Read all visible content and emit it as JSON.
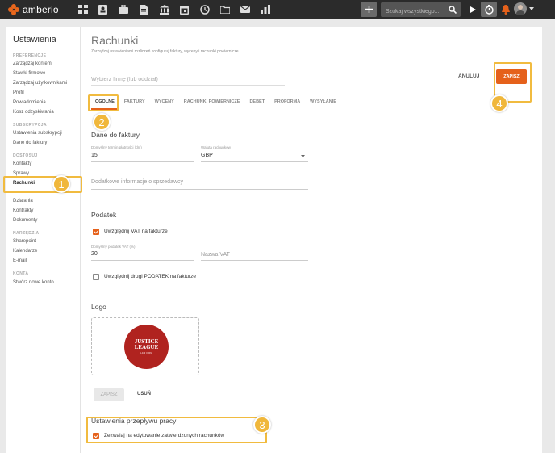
{
  "topbar": {
    "brand": "amberio",
    "search_placeholder": "Szukaj wszystkiego...",
    "nav_icons": [
      "dashboard-icon",
      "contacts-icon",
      "briefcase-icon",
      "document-icon",
      "bank-icon",
      "calendar-icon",
      "history-icon",
      "folder-icon",
      "email-icon",
      "chart-icon"
    ],
    "actions": [
      "add-icon",
      "play-icon",
      "timer-icon",
      "notification-icon",
      "user-avatar"
    ]
  },
  "sidebar": {
    "title": "Ustawienia",
    "sections": [
      {
        "label": "PREFERENCJE",
        "items": [
          "Zarządzaj kontem",
          "Stawki firmowe",
          "Zarządzaj użytkownikami",
          "Profil",
          "Powiadomienia",
          "Kosz odzyskiwania"
        ]
      },
      {
        "label": "SUBSKRYPCJA",
        "items": [
          "Ustawienia subskrypcji",
          "Dane do faktury"
        ]
      },
      {
        "label": "DOSTOSUJ",
        "items": [
          "Kontakty",
          "Sprawy",
          "Rachunki",
          "Działania",
          "Kontrakty",
          "Dokumenty"
        ]
      },
      {
        "label": "NARZĘDZIA",
        "items": [
          "Sharepoint",
          "Kalendarze",
          "E-mail"
        ]
      },
      {
        "label": "KONTA",
        "items": [
          "Stwórz nowe konto"
        ]
      }
    ],
    "active_item": "Rachunki"
  },
  "main": {
    "title": "Rachunki",
    "subtitle": "Zarządzaj ustawieniami rozliczeń konfiguruj faktury, wyceny i rachunki powiernicze",
    "company_placeholder": "Wybierz firmę (lub oddział)",
    "cancel_label": "ANULUJ",
    "save_label": "ZAPISZ",
    "tabs": [
      "OGÓLNE",
      "FAKTURY",
      "WYCENY",
      "RACHUNKI POWIERNICZE",
      "DEBET",
      "PROFORMA",
      "WYSYŁANIE"
    ],
    "active_tab": "OGÓLNE"
  },
  "invoice_data": {
    "title": "Dane do faktury",
    "due_label": "Domyślny termin płatności (dni)",
    "due_value": "15",
    "currency_label": "Waluta rachunków",
    "currency_value": "GBP",
    "extra_placeholder": "Dodatkowe informacje o sprzedawcy"
  },
  "tax": {
    "title": "Podatek",
    "include_vat_label": "Uwzględnij VAT na fakturze",
    "include_vat_checked": true,
    "vat_rate_label": "Domyślny podatek VAT (%)",
    "vat_rate_value": "20",
    "vat_name_placeholder": "Nazwa VAT",
    "second_tax_label": "Uwzględnij drugi PODATEK na fakturze",
    "second_tax_checked": false
  },
  "logo": {
    "title": "Logo",
    "image_line1": "JUSTICE",
    "image_line2": "LEAGUE",
    "image_line3": "LAW FIRM",
    "save_label": "ZAPISZ",
    "remove_label": "USUŃ"
  },
  "workflow": {
    "title": "Ustawienia przepływu pracy",
    "allow_edit_label": "Zezwalaj na edytowanie zatwierdzonych rachunków",
    "allow_edit_checked": true
  },
  "annotations": [
    "1",
    "2",
    "3",
    "4"
  ],
  "colors": {
    "accent": "#e5611b",
    "highlight": "#f1bb3f",
    "topbar": "#2b2b2b"
  }
}
